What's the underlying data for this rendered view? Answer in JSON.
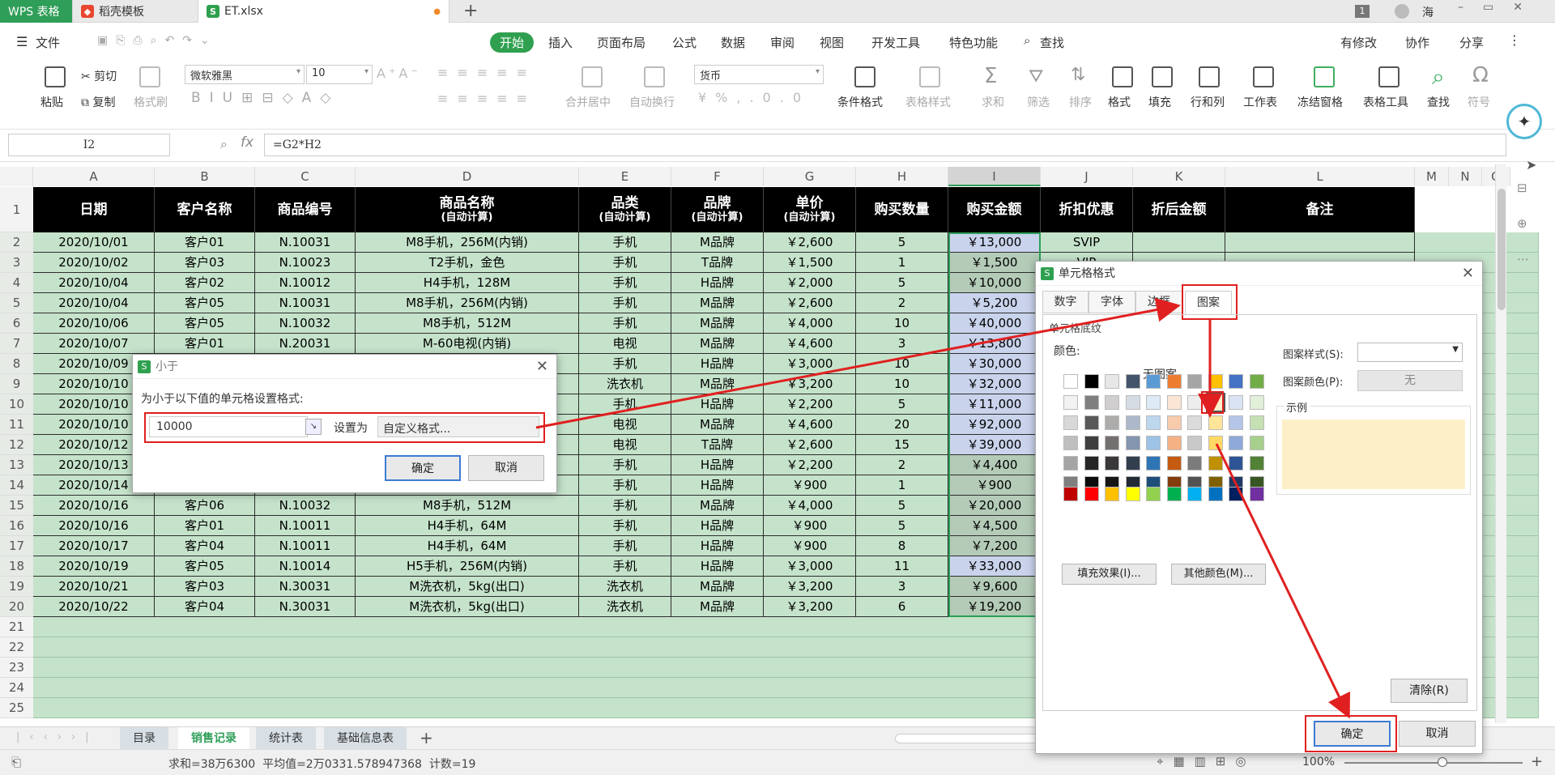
{
  "app_tabs": [
    {
      "label": "WPS 表格",
      "icon": ""
    },
    {
      "label": "稻壳模板",
      "icon": "daoke-icon"
    },
    {
      "label": "ET.xlsx",
      "icon": "S"
    }
  ],
  "window": {
    "badge": "1",
    "user": "海"
  },
  "menu": {
    "file": "文件",
    "items": [
      "开始",
      "插入",
      "页面布局",
      "公式",
      "数据",
      "审阅",
      "视图",
      "开发工具",
      "特色功能"
    ],
    "search": "查找",
    "right": [
      "有修改",
      "协作",
      "分享"
    ]
  },
  "ribbon": {
    "paste": "粘贴",
    "cut": "剪切",
    "copy": "复制",
    "format_painter": "格式刷",
    "font": "微软雅黑",
    "size": "10",
    "merge": "合并居中",
    "wrap": "自动换行",
    "num_format": "货币",
    "cond_format": "条件格式",
    "table_style": "表格样式",
    "sum": "求和",
    "filter": "筛选",
    "sort": "排序",
    "format": "格式",
    "fill": "填充",
    "rowcol": "行和列",
    "worksheet": "工作表",
    "freeze": "冻结窗格",
    "table_tools": "表格工具",
    "find": "查找",
    "symbol": "符号"
  },
  "formula_bar": {
    "cell_ref": "I2",
    "fx": "fx",
    "formula": "=G2*H2"
  },
  "columns": [
    "A",
    "B",
    "C",
    "D",
    "E",
    "F",
    "G",
    "H",
    "I",
    "J",
    "K",
    "L",
    "M",
    "N",
    "O"
  ],
  "headers": [
    {
      "main": "日期",
      "sub": ""
    },
    {
      "main": "客户名称",
      "sub": ""
    },
    {
      "main": "商品编号",
      "sub": ""
    },
    {
      "main": "商品名称",
      "sub": "(自动计算)"
    },
    {
      "main": "品类",
      "sub": "(自动计算)"
    },
    {
      "main": "品牌",
      "sub": "(自动计算)"
    },
    {
      "main": "单价",
      "sub": "(自动计算)"
    },
    {
      "main": "购买数量",
      "sub": ""
    },
    {
      "main": "购买金额",
      "sub": ""
    },
    {
      "main": "折扣优惠",
      "sub": ""
    },
    {
      "main": "折后金额",
      "sub": ""
    },
    {
      "main": "备注",
      "sub": ""
    }
  ],
  "rows": [
    [
      "2020/10/01",
      "客户01",
      "N.10031",
      "M8手机，256M(内销)",
      "手机",
      "M品牌",
      "￥2,600",
      "5",
      "￥13,000",
      "SVIP"
    ],
    [
      "2020/10/02",
      "客户03",
      "N.10023",
      "T2手机，金色",
      "手机",
      "T品牌",
      "￥1,500",
      "1",
      "￥1,500",
      "VIP"
    ],
    [
      "2020/10/04",
      "客户02",
      "N.10012",
      "H4手机，128M",
      "手机",
      "H品牌",
      "￥2,000",
      "5",
      "￥10,000",
      ""
    ],
    [
      "2020/10/04",
      "客户05",
      "N.10031",
      "M8手机，256M(内销)",
      "手机",
      "M品牌",
      "￥2,600",
      "2",
      "￥5,200",
      ""
    ],
    [
      "2020/10/06",
      "客户05",
      "N.10032",
      "M8手机，512M",
      "手机",
      "M品牌",
      "￥4,000",
      "10",
      "￥40,000",
      ""
    ],
    [
      "2020/10/07",
      "客户01",
      "N.20031",
      "M-60电视(内销)",
      "电视",
      "M品牌",
      "￥4,600",
      "3",
      "￥13,800",
      ""
    ],
    [
      "2020/10/09",
      "",
      "",
      "",
      "手机",
      "H品牌",
      "￥3,000",
      "10",
      "￥30,000",
      ""
    ],
    [
      "2020/10/10",
      "",
      "",
      "",
      "洗衣机",
      "M品牌",
      "￥3,200",
      "10",
      "￥32,000",
      ""
    ],
    [
      "2020/10/10",
      "",
      "",
      "",
      "手机",
      "H品牌",
      "￥2,200",
      "5",
      "￥11,000",
      ""
    ],
    [
      "2020/10/10",
      "",
      "",
      "",
      "电视",
      "M品牌",
      "￥4,600",
      "20",
      "￥92,000",
      ""
    ],
    [
      "2020/10/12",
      "",
      "",
      "",
      "电视",
      "T品牌",
      "￥2,600",
      "15",
      "￥39,000",
      ""
    ],
    [
      "2020/10/13",
      "",
      "",
      "",
      "手机",
      "H品牌",
      "￥2,200",
      "2",
      "￥4,400",
      ""
    ],
    [
      "2020/10/14",
      "",
      "",
      "",
      "手机",
      "H品牌",
      "￥900",
      "1",
      "￥900",
      ""
    ],
    [
      "2020/10/16",
      "客户06",
      "N.10032",
      "M8手机，512M",
      "手机",
      "M品牌",
      "￥4,000",
      "5",
      "￥20,000",
      ""
    ],
    [
      "2020/10/16",
      "客户01",
      "N.10011",
      "H4手机，64M",
      "手机",
      "H品牌",
      "￥900",
      "5",
      "￥4,500",
      ""
    ],
    [
      "2020/10/17",
      "客户04",
      "N.10011",
      "H4手机，64M",
      "手机",
      "H品牌",
      "￥900",
      "8",
      "￥7,200",
      ""
    ],
    [
      "2020/10/19",
      "客户05",
      "N.10014",
      "H5手机，256M(内销)",
      "手机",
      "H品牌",
      "￥3,000",
      "11",
      "￥33,000",
      ""
    ],
    [
      "2020/10/21",
      "客户03",
      "N.30031",
      "M洗衣机，5kg(出口)",
      "洗衣机",
      "M品牌",
      "￥3,200",
      "3",
      "￥9,600",
      ""
    ],
    [
      "2020/10/22",
      "客户04",
      "N.30031",
      "M洗衣机，5kg(出口)",
      "洗衣机",
      "M品牌",
      "￥3,200",
      "6",
      "￥19,200",
      ""
    ]
  ],
  "sheet_tabs": [
    "目录",
    "销售记录",
    "统计表",
    "基础信息表"
  ],
  "status": "求和=38万6300  平均值=2万0331.578947368  计数=19",
  "zoom": "100%",
  "lt_dialog": {
    "title": "小于",
    "label": "为小于以下值的单元格设置格式:",
    "value": "10000",
    "set_as": "设置为",
    "format": "自定义格式...",
    "ok": "确定",
    "cancel": "取消"
  },
  "fmt_dialog": {
    "title": "单元格格式",
    "tabs": [
      "数字",
      "字体",
      "边框",
      "图案"
    ],
    "section": "单元格底纹",
    "color_label": "颜色:",
    "no_pattern": "无图案",
    "fill_effects": "填充效果(I)...",
    "more_colors": "其他颜色(M)...",
    "pattern_style_label": "图案样式(S):",
    "pattern_color_label": "图案颜色(P):",
    "pattern_color_value": "无",
    "sample_label": "示例",
    "sample_color": "#fdf0c8",
    "clear": "清除(R)",
    "ok": "确定",
    "cancel": "取消"
  },
  "colors": {
    "accent": "#2f9e58",
    "data_green": "#c5e3cb",
    "highlight_blue": "#c9d3ec",
    "annotation_red": "#e02020"
  }
}
